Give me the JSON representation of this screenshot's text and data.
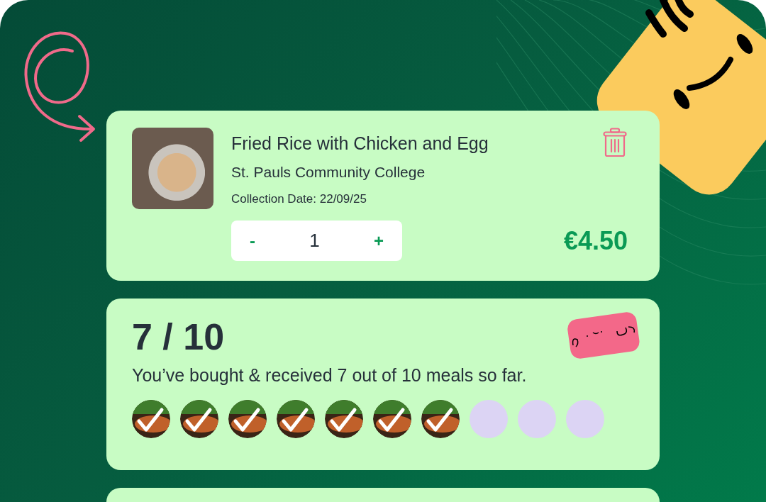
{
  "cart_item": {
    "title": "Fried Rice with Chicken and Egg",
    "location": "St. Pauls Community College",
    "collection_date": "Collection Date: 22/09/25",
    "quantity": {
      "decrement": "-",
      "value": "1",
      "increment": "+"
    },
    "price": "€4.50"
  },
  "progress": {
    "count": "7 / 10",
    "message": "You’ve bought & received 7 out of 10 meals so far.",
    "meals": [
      {
        "checked": true
      },
      {
        "checked": true
      },
      {
        "checked": true
      },
      {
        "checked": true
      },
      {
        "checked": true
      },
      {
        "checked": true
      },
      {
        "checked": true
      },
      {
        "checked": false
      },
      {
        "checked": false
      },
      {
        "checked": false
      }
    ]
  }
}
